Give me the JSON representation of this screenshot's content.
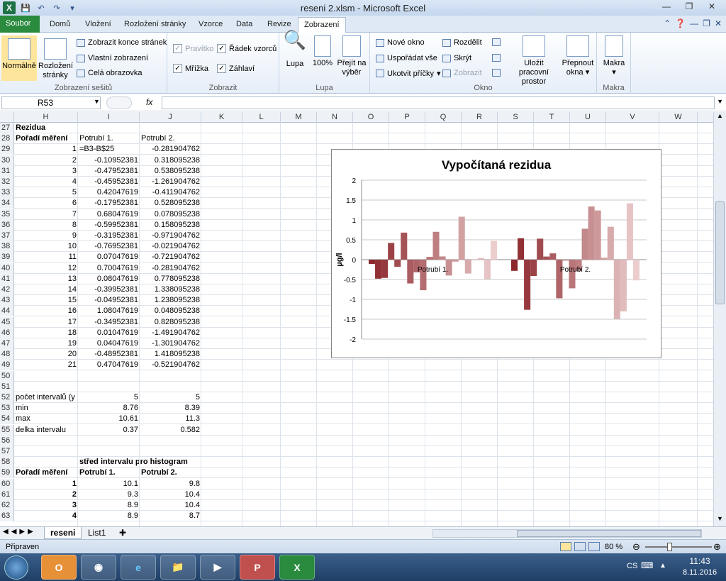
{
  "window": {
    "title": "reseni 2.xlsm - Microsoft Excel"
  },
  "tabs": {
    "file": "Soubor",
    "items": [
      "Domů",
      "Vložení",
      "Rozložení stránky",
      "Vzorce",
      "Data",
      "Revize",
      "Zobrazení"
    ]
  },
  "ribbon": {
    "g1": {
      "normal": "Normálně",
      "layout1": "Rozložení",
      "layout2": "stránky",
      "b1": "Zobrazit konce stránek",
      "b2": "Vlastní zobrazení",
      "b3": "Celá obrazovka",
      "label": "Zobrazení sešitů"
    },
    "g2": {
      "pravitko": "Pravítko",
      "radek": "Řádek vzorců",
      "mrizka": "Mřížka",
      "zahlavi": "Záhlaví",
      "label": "Zobrazit"
    },
    "g3": {
      "lupa": "Lupa",
      "p100": "100%",
      "vyber1": "Přejít na",
      "vyber2": "výběr",
      "label": "Lupa"
    },
    "g4": {
      "nove": "Nové okno",
      "usporadat": "Uspořádat vše",
      "ukotvit": "Ukotvit příčky",
      "rozdelit": "Rozdělit",
      "skryt": "Skrýt",
      "zobrazit": "Zobrazit",
      "ulozit1": "Uložit pracovní",
      "ulozit2": "prostor",
      "prepnout1": "Přepnout",
      "prepnout2": "okna",
      "label": "Okno"
    },
    "g5": {
      "makra": "Makra",
      "label": "Makra"
    }
  },
  "formula": {
    "namebox": "R53",
    "fx": "fx"
  },
  "columns": [
    "H",
    "I",
    "J",
    "K",
    "L",
    "M",
    "N",
    "O",
    "P",
    "Q",
    "R",
    "S",
    "T",
    "U",
    "V",
    "W"
  ],
  "rows": {
    "r27": {
      "num": "27",
      "H": "Rezidua"
    },
    "r28": {
      "num": "28",
      "H": "Pořadí měření",
      "I": "Potrubí 1.",
      "J": "Potrubí 2."
    },
    "r29": {
      "num": "29",
      "H": "1",
      "I": "=B3-B$25",
      "J": "-0.281904762"
    },
    "r30": {
      "num": "30",
      "H": "2",
      "I": "-0.10952381",
      "J": "0.318095238"
    },
    "r31": {
      "num": "31",
      "H": "3",
      "I": "-0.47952381",
      "J": "0.538095238"
    },
    "r32": {
      "num": "32",
      "H": "4",
      "I": "-0.45952381",
      "J": "-1.261904762"
    },
    "r33": {
      "num": "33",
      "H": "5",
      "I": "0.42047619",
      "J": "-0.411904762"
    },
    "r34": {
      "num": "34",
      "H": "6",
      "I": "-0.17952381",
      "J": "0.528095238"
    },
    "r35": {
      "num": "35",
      "H": "7",
      "I": "0.68047619",
      "J": "0.078095238"
    },
    "r36": {
      "num": "36",
      "H": "8",
      "I": "-0.59952381",
      "J": "0.158095238"
    },
    "r37": {
      "num": "37",
      "H": "9",
      "I": "-0.31952381",
      "J": "-0.971904762"
    },
    "r38": {
      "num": "38",
      "H": "10",
      "I": "-0.76952381",
      "J": "-0.021904762"
    },
    "r39": {
      "num": "39",
      "H": "11",
      "I": "0.07047619",
      "J": "-0.721904762"
    },
    "r40": {
      "num": "40",
      "H": "12",
      "I": "0.70047619",
      "J": "-0.281904762"
    },
    "r41": {
      "num": "41",
      "H": "13",
      "I": "0.08047619",
      "J": "0.778095238"
    },
    "r42": {
      "num": "42",
      "H": "14",
      "I": "-0.39952381",
      "J": "1.338095238"
    },
    "r43": {
      "num": "43",
      "H": "15",
      "I": "-0.04952381",
      "J": "1.238095238"
    },
    "r44": {
      "num": "44",
      "H": "16",
      "I": "1.08047619",
      "J": "0.048095238"
    },
    "r45": {
      "num": "45",
      "H": "17",
      "I": "-0.34952381",
      "J": "0.828095238"
    },
    "r46": {
      "num": "46",
      "H": "18",
      "I": "0.01047619",
      "J": "-1.491904762"
    },
    "r47": {
      "num": "47",
      "H": "19",
      "I": "0.04047619",
      "J": "-1.301904762"
    },
    "r48": {
      "num": "48",
      "H": "20",
      "I": "-0.48952381",
      "J": "1.418095238"
    },
    "r49": {
      "num": "49",
      "H": "21",
      "I": "0.47047619",
      "J": "-0.521904762"
    },
    "r50": {
      "num": "50"
    },
    "r51": {
      "num": "51"
    },
    "r52": {
      "num": "52",
      "H": "počet intervalů (y",
      "I": "5",
      "J": "5"
    },
    "r53": {
      "num": "53",
      "H": "min",
      "I": "8.76",
      "J": "8.39"
    },
    "r54": {
      "num": "54",
      "H": "max",
      "I": "10.61",
      "J": "11.3"
    },
    "r55": {
      "num": "55",
      "H": "delka intervalu",
      "I": "0.37",
      "J": "0.582"
    },
    "r56": {
      "num": "56"
    },
    "r57": {
      "num": "57"
    },
    "r58": {
      "num": "58",
      "I": "střed intervalu pro histogram"
    },
    "r59": {
      "num": "59",
      "H": "Pořadí měření",
      "I": "Potrubí 1.",
      "J": "Potrubí 2."
    },
    "r60": {
      "num": "60",
      "H": "1",
      "I": "10.1",
      "J": "9.8"
    },
    "r61": {
      "num": "61",
      "H": "2",
      "I": "9.3",
      "J": "10.4"
    },
    "r62": {
      "num": "62",
      "H": "3",
      "I": "8.9",
      "J": "10.4"
    },
    "r63": {
      "num": "63",
      "H": "4",
      "I": "8.9",
      "J": "8.7"
    }
  },
  "chart_data": {
    "type": "bar",
    "title": "Vypočítaná rezidua",
    "ylabel": "µg/l",
    "categories": [
      "Potrubí 1.",
      "Potrubí 2."
    ],
    "ylim": [
      -2,
      2
    ],
    "yticks": [
      "2",
      "1.5",
      "1",
      "0.5",
      "0",
      "-0.5",
      "-1",
      "-1.5",
      "-2"
    ],
    "series_values": [
      [
        -0.1095,
        -0.2819,
        0.3181
      ],
      [
        -0.4795,
        0.5381
      ],
      [
        -0.4595,
        -1.2619
      ],
      [
        0.4205,
        -0.4119
      ],
      [
        -0.1795,
        0.5281
      ],
      [
        0.6805,
        0.0781
      ],
      [
        -0.5995,
        0.1581
      ],
      [
        -0.3195,
        -0.9719
      ],
      [
        -0.7695,
        -0.0219
      ],
      [
        0.0705,
        -0.7219
      ],
      [
        0.7005,
        -0.2819
      ],
      [
        0.0805,
        0.7781
      ],
      [
        -0.3995,
        1.3381
      ],
      [
        -0.0495,
        1.2381
      ],
      [
        1.0805,
        0.0481
      ],
      [
        -0.3495,
        0.8281
      ],
      [
        0.0105,
        -1.4919
      ],
      [
        0.0405,
        -1.3019
      ],
      [
        -0.4895,
        1.4181
      ],
      [
        0.4705,
        -0.5219
      ]
    ],
    "p1": [
      -0.1095,
      -0.4795,
      -0.4595,
      0.4205,
      -0.1795,
      0.6805,
      -0.5995,
      -0.3195,
      -0.7695,
      0.0705,
      0.7005,
      0.0805,
      -0.3995,
      -0.0495,
      1.0805,
      -0.3495,
      0.0105,
      0.0405,
      -0.4895,
      0.4705
    ],
    "p2": [
      -0.2819,
      0.5381,
      -1.2619,
      -0.4119,
      0.5281,
      0.0781,
      0.1581,
      -0.9719,
      -0.0219,
      -0.7219,
      -0.2819,
      0.7781,
      1.3381,
      1.2381,
      0.0481,
      0.8281,
      -1.4919,
      -1.3019,
      1.4181,
      -0.5219
    ]
  },
  "sheets": [
    "reseni",
    "List1"
  ],
  "status": {
    "ready": "Připraven",
    "zoom": "80 %"
  },
  "taskbar": {
    "lang": "CS",
    "time": "11:43",
    "date": "8.11.2016"
  }
}
